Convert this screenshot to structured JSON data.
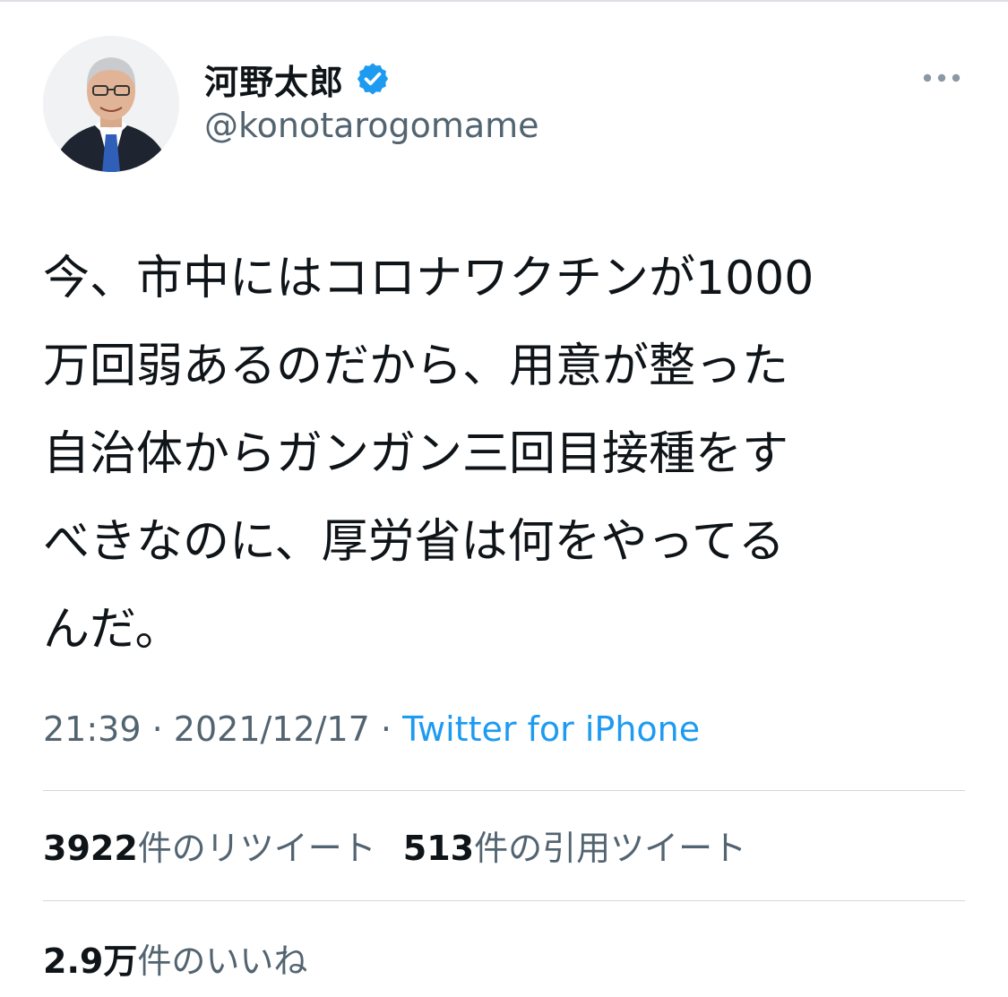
{
  "author": {
    "display_name": "河野太郎",
    "handle": "@konotarogomame",
    "verified_icon": "verified-badge-icon",
    "avatar": "profile-photo"
  },
  "menu_icon": "more-horizontal-icon",
  "tweet": {
    "text": "今、市中にはコロナワクチンが1000\n万回弱あるのだから、用意が整った\n自治体からガンガン三回目接種をす\nべきなのに、厚労省は何をやってる\nんだ。",
    "time": "21:39",
    "date": "2021/12/17",
    "separator": "·",
    "source": "Twitter for iPhone"
  },
  "stats": {
    "retweets_count": "3922",
    "retweets_label": "件のリツイート",
    "quotes_count": "513",
    "quotes_label": "件の引用ツイート",
    "likes_count": "2.9万",
    "likes_label": "件のいいね"
  },
  "colors": {
    "link": "#1d9bf0",
    "secondary_text": "#536471",
    "primary_text": "#0f1419",
    "divider": "#d3d8dc"
  }
}
